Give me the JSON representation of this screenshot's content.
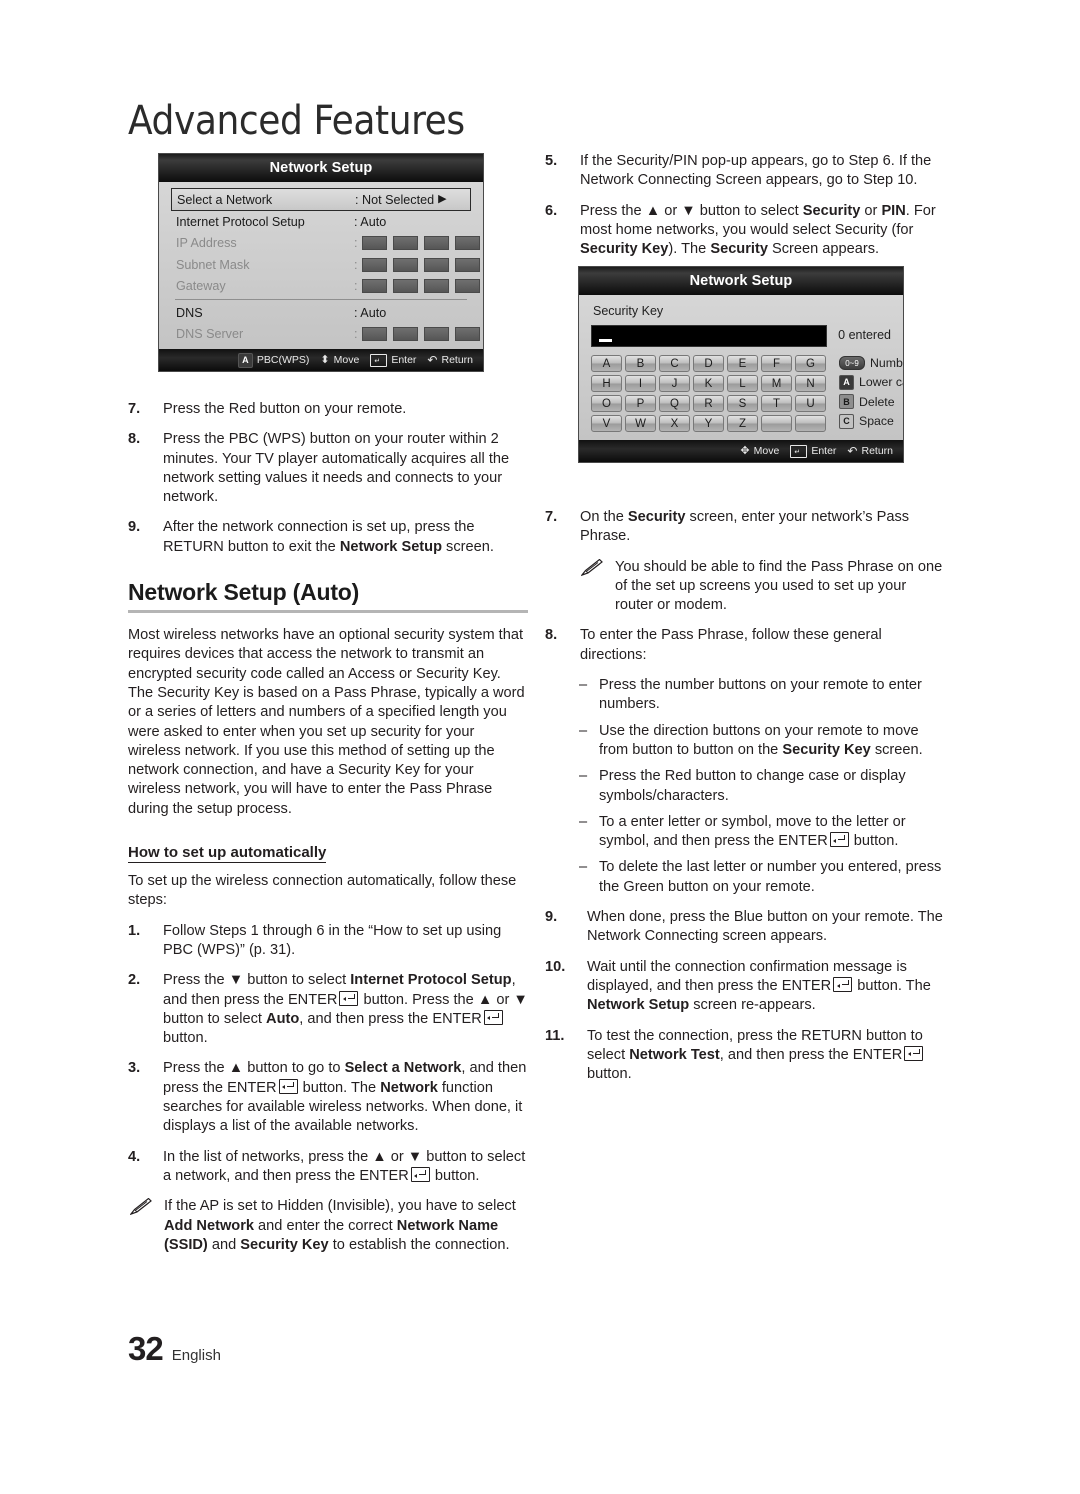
{
  "chapter_title": "Advanced Features",
  "page_footer": {
    "number": "32",
    "language": "English"
  },
  "screen1": {
    "title": "Network Setup",
    "rows": [
      {
        "label": "Select a Network",
        "value": ": Not Selected",
        "arrow": "▶",
        "state": "selected"
      },
      {
        "label": "Internet Protocol Setup",
        "value": ": Auto",
        "state": "normal"
      },
      {
        "label": "IP Address",
        "value": ":",
        "state": "dim",
        "boxes": 4
      },
      {
        "label": "Subnet Mask",
        "value": ":",
        "state": "dim",
        "boxes": 4
      },
      {
        "label": "Gateway",
        "value": ":",
        "state": "dim",
        "boxes": 4
      },
      {
        "label": "DNS",
        "value": ": Auto",
        "state": "normal"
      },
      {
        "label": "DNS Server",
        "value": ":",
        "state": "dim",
        "boxes": 4
      }
    ],
    "footer": [
      {
        "icon": "A",
        "label": "PBC(WPS)"
      },
      {
        "icon": "updown",
        "label": "Move"
      },
      {
        "icon": "enter",
        "label": "Enter"
      },
      {
        "icon": "return",
        "label": "Return"
      }
    ]
  },
  "screen2": {
    "title": "Network Setup",
    "field_label": "Security Key",
    "input_value": "",
    "entered_text": "0 entered",
    "keys": [
      "A",
      "B",
      "C",
      "D",
      "E",
      "F",
      "G",
      "H",
      "I",
      "J",
      "K",
      "L",
      "M",
      "N",
      "O",
      "P",
      "Q",
      "R",
      "S",
      "T",
      "U",
      "V",
      "W",
      "X",
      "Y",
      "Z",
      "",
      ""
    ],
    "legend": [
      {
        "icon": "0~9",
        "label": "Number"
      },
      {
        "icon": "A",
        "label": "Lower case"
      },
      {
        "icon": "B",
        "label": "Delete"
      },
      {
        "icon": "C",
        "label": "Space"
      }
    ],
    "footer": [
      {
        "icon": "move",
        "label": "Move"
      },
      {
        "icon": "enter",
        "label": "Enter"
      },
      {
        "icon": "return",
        "label": "Return"
      }
    ]
  },
  "left_column": {
    "steps_top": [
      {
        "num": "7.",
        "html": "Press the Red button on your remote."
      },
      {
        "num": "8.",
        "html": "Press the PBC (WPS) button on your router within 2 minutes. Your TV player automatically acquires all the network setting values it needs and connects to your network."
      },
      {
        "num": "9.",
        "html": "After the network connection is set up, press the RETURN button to exit the <b>Network Setup</b> screen."
      }
    ],
    "section_heading": "Network Setup (Auto)",
    "section_paragraph": "Most wireless networks have an optional security system that requires devices that access the network to transmit an encrypted security code called an Access or Security Key. The Security Key is based on a Pass Phrase, typically a word or a series of letters and numbers of a specified length you were asked to enter when you set up security for your wireless network.  If you use this method of setting up the network connection, and have a Security Key for your wireless network, you will have to enter the Pass Phrase during the setup process.",
    "sub_heading": "How to set up automatically",
    "sub_intro": "To set up the wireless connection automatically, follow these steps:",
    "steps": [
      {
        "num": "1.",
        "html": "Follow Steps 1 through 6 in the “How to set up using PBC (WPS)” (p. 31)."
      },
      {
        "num": "2.",
        "html": "Press the ▼ button to select <b>Internet Protocol Setup</b>, and then press the ENTER<span class=\"enter-key\" data-name=\"enter-key-icon\"></span> button. Press the ▲ or ▼ button to select <b>Auto</b>, and then press the ENTER<span class=\"enter-key\" data-name=\"enter-key-icon\"></span> button."
      },
      {
        "num": "3.",
        "html": "Press the ▲ button to go to <b>Select a Network</b>, and then press the ENTER<span class=\"enter-key\" data-name=\"enter-key-icon\"></span> button. The <b>Network</b> function searches for available wireless networks. When done, it displays a list of the available networks."
      },
      {
        "num": "4.",
        "html": "In the list of networks, press the ▲ or ▼ button to select a network, and then press the ENTER<span class=\"enter-key\" data-name=\"enter-key-icon\"></span> button."
      }
    ],
    "note": "If the AP is set to Hidden (Invisible), you have to select <b>Add Network</b> and enter the correct <b>Network Name (SSID)</b> and <b>Security Key</b> to establish the connection."
  },
  "right_column": {
    "steps_top": [
      {
        "num": "5.",
        "html": "If the Security/PIN pop-up appears, go to Step 6. If the Network Connecting Screen appears, go to Step 10."
      },
      {
        "num": "6.",
        "html": "Press the ▲ or ▼ button to select <b>Security</b> or <b>PIN</b>. For most home networks, you would select Security (for <b>Security Key</b>). The <b>Security</b> Screen appears."
      }
    ],
    "step7": {
      "num": "7.",
      "html": "On the <b>Security</b> screen, enter your network’s Pass Phrase."
    },
    "note7": "You should be able to find the Pass Phrase on one of the set up screens you used to set up your router or modem.",
    "step8": {
      "num": "8.",
      "html": "To enter the Pass Phrase, follow these general directions:"
    },
    "step8_bullets": [
      "Press the number buttons on your remote to enter numbers.",
      "Use the direction buttons on your remote to move from button to button on the <b>Security Key</b> screen.",
      "Press the Red button to change case or display symbols/characters.",
      "To a enter letter or symbol, move to the letter or symbol, and then press the ENTER<span class=\"enter-key\" data-name=\"enter-key-icon\"></span> button.",
      "To delete the last letter or number you entered, press the Green button on your remote."
    ],
    "steps_end": [
      {
        "num": "9.",
        "html": "When done, press the Blue button on your remote. The Network Connecting screen appears."
      },
      {
        "num": "10.",
        "html": "Wait until the connection confirmation message is displayed, and then press the ENTER<span class=\"enter-key\" data-name=\"enter-key-icon\"></span> button. The <b>Network Setup</b> screen re-appears."
      },
      {
        "num": "11.",
        "html": "To test the connection, press the RETURN button to select <b>Network Test</b>, and then press the ENTER<span class=\"enter-key\" data-name=\"enter-key-icon\"></span> button."
      }
    ]
  }
}
